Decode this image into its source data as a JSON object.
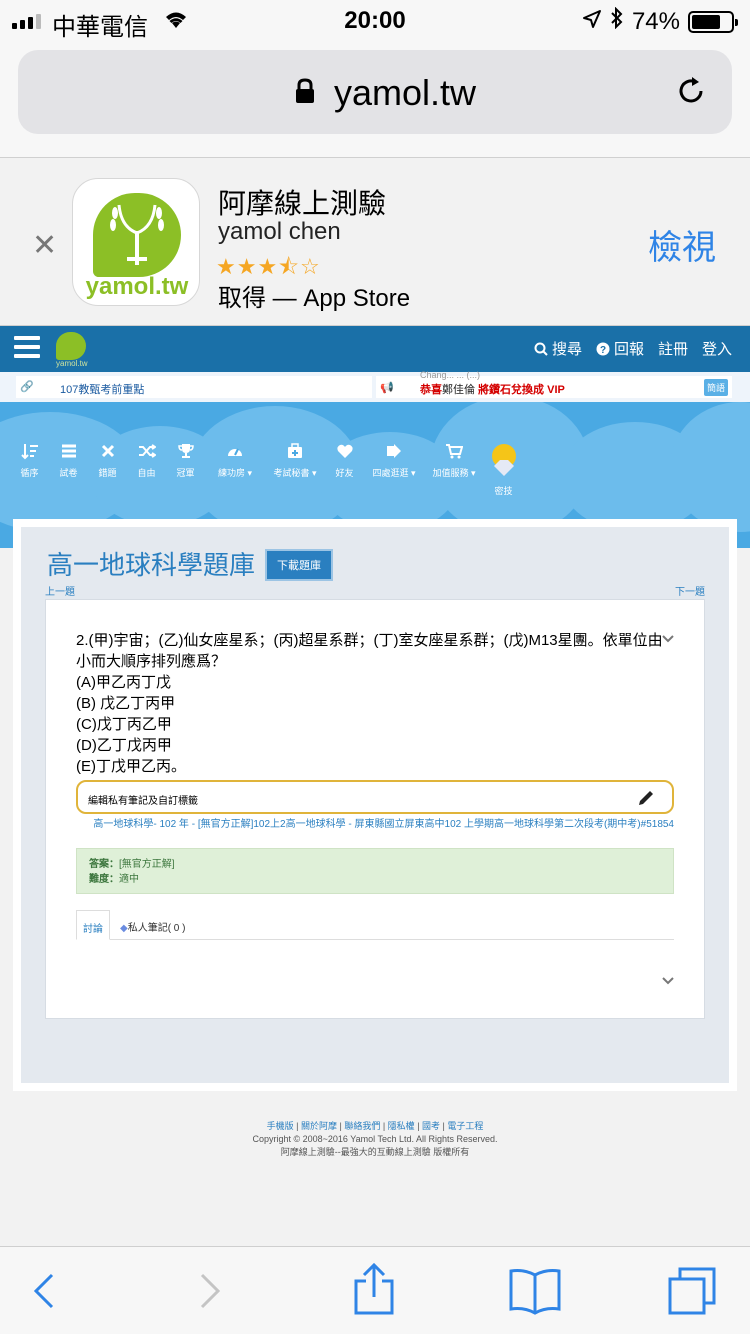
{
  "status_bar": {
    "carrier": "中華電信",
    "time": "20:00",
    "battery": "74%",
    "battery_level": 0.74,
    "icons": [
      "signal-icon",
      "wifi-icon",
      "location-icon",
      "bluetooth-icon",
      "battery-icon"
    ]
  },
  "browser": {
    "domain": "yamol.tw"
  },
  "app_banner": {
    "app_name": "阿摩線上測驗",
    "developer": "yamol chen",
    "stars": "★★★⯪☆",
    "rating": 3.5,
    "store_text": "取得 — App Store",
    "view_label": "檢視",
    "icon_word": "yamol.tw",
    "brand_color": "#8cbf26"
  },
  "site_nav": {
    "logo_text": "yamol.tw",
    "search_label": "搜尋",
    "report_label": "回報",
    "register_label": "註冊",
    "login_label": "登入",
    "nav_color": "#1a70a8"
  },
  "ticker": {
    "left_text": "107教甄考前重點",
    "right_overflow": "Chang... ... (...)",
    "right_prefix": "恭喜",
    "right_name": "鄭佳倫",
    "right_text": "將鑽石兌換成 VIP",
    "right_button": "簡語"
  },
  "toolbar": {
    "items": [
      {
        "label": "循序",
        "icon": "sort-icon"
      },
      {
        "label": "試卷",
        "icon": "list-icon"
      },
      {
        "label": "錯題",
        "icon": "close-icon"
      },
      {
        "label": "自由",
        "icon": "shuffle-icon"
      },
      {
        "label": "冠軍",
        "icon": "trophy-icon"
      },
      {
        "label": "練功房 ▾",
        "icon": "dashboard-icon"
      },
      {
        "label": "考試秘書 ▾",
        "icon": "briefcase-icon"
      },
      {
        "label": "好友",
        "icon": "heart-icon"
      },
      {
        "label": "四處逛逛 ▾",
        "icon": "signout-icon"
      },
      {
        "label": "加值服務 ▾",
        "icon": "cart-icon"
      },
      {
        "label": "密技",
        "icon": "diamond-icon"
      }
    ]
  },
  "page": {
    "title": "高一地球科學題庫",
    "download_label": "下載題庫",
    "prev_label": "上一題",
    "next_label": "下一題"
  },
  "question": {
    "text": "2.(甲)宇宙；(乙)仙女座星系；(丙)超星系群；(丁)室女座星系群；(戊)M13星團。依單位由小而大順序排列應爲？",
    "options": [
      "(A)甲乙丙丁戊",
      "(B) 戊乙丁丙甲",
      "(C)戊丁丙乙甲",
      "(D)乙丁戊丙甲",
      "(E)丁戊甲乙丙。"
    ],
    "note_label": "編輯私有筆記及自訂標籤",
    "source": "高一地球科學- 102 年 - [無官方正解]102上2高一地球科學 - 屏東縣國立屏東高中102 上學期高一地球科學第二次段考(期中考)#51854",
    "answer_label": "答案：",
    "answer_value": "[無官方正解]",
    "difficulty_label": "難度：",
    "difficulty_value": "適中"
  },
  "tabs": {
    "discussion": "討論",
    "private_notes": "私人筆記( 0 )"
  },
  "footer": {
    "links": [
      "手機版",
      "關於阿摩",
      "聯絡我們",
      "隱私權",
      "國考",
      "電子工程"
    ],
    "copyright": "Copyright © 2008~2016 Yamol Tech Ltd. All Rights Reserved.",
    "tagline": "阿摩線上測驗--最強大的互動線上測驗 版權所有"
  }
}
